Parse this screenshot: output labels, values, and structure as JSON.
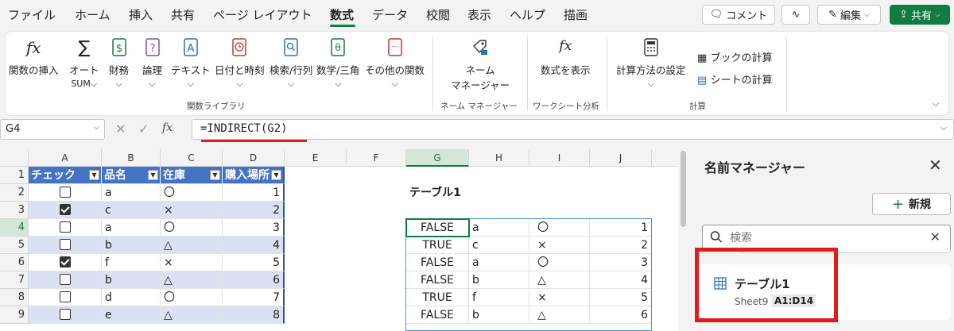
{
  "menubar": {
    "tabs": [
      "ファイル",
      "ホーム",
      "挿入",
      "共有",
      "ページ レイアウト",
      "数式",
      "データ",
      "校閲",
      "表示",
      "ヘルプ",
      "描画"
    ],
    "active_tab": "数式",
    "comment_label": "コメント",
    "edit_label": "編集",
    "share_label": "共有"
  },
  "ribbon": {
    "insert_function": "関数の挿入",
    "autosum": "オート",
    "autosum_sub": "SUM",
    "financial": "財務",
    "logical": "論理",
    "text": "テキスト",
    "datetime": "日付と時刻",
    "lookup": "検索/行列",
    "math": "数学/三角",
    "more": "その他の関数",
    "group_library": "関数ライブラリ",
    "name_manager_line1": "ネーム",
    "name_manager_line2": "マネージャー",
    "group_names": "ネーム マネージャー",
    "show_formulas": "数式を表示",
    "group_audit": "ワークシート分析",
    "calc_options": "計算方法の設定",
    "calc_book": "ブックの計算",
    "calc_sheet": "シートの計算",
    "group_calc": "計算"
  },
  "formula_bar": {
    "name_box": "G4",
    "formula": "=INDIRECT(G2)",
    "fx": "fx"
  },
  "grid": {
    "columns": [
      "A",
      "B",
      "C",
      "D",
      "E",
      "F",
      "G",
      "H",
      "I",
      "J"
    ],
    "rows": [
      "1",
      "2",
      "3",
      "4",
      "5",
      "6",
      "7",
      "8",
      "9"
    ],
    "table_headers": [
      "チェック",
      "品名",
      "在庫",
      "購入場所"
    ],
    "table_rows": [
      {
        "checked": false,
        "name": "a",
        "stock": "〇",
        "place": "1"
      },
      {
        "checked": true,
        "name": "c",
        "stock": "×",
        "place": "2"
      },
      {
        "checked": false,
        "name": "a",
        "stock": "〇",
        "place": "3"
      },
      {
        "checked": false,
        "name": "b",
        "stock": "△",
        "place": "4"
      },
      {
        "checked": true,
        "name": "f",
        "stock": "×",
        "place": "5"
      },
      {
        "checked": false,
        "name": "b",
        "stock": "△",
        "place": "6"
      },
      {
        "checked": false,
        "name": "d",
        "stock": "〇",
        "place": "7"
      },
      {
        "checked": false,
        "name": "e",
        "stock": "△",
        "place": "8"
      }
    ],
    "g2_label": "テーブル1",
    "spill_rows": [
      {
        "g": "FALSE",
        "h": "a",
        "i": "〇",
        "j": "1"
      },
      {
        "g": "TRUE",
        "h": "c",
        "i": "×",
        "j": "2"
      },
      {
        "g": "FALSE",
        "h": "a",
        "i": "〇",
        "j": "3"
      },
      {
        "g": "FALSE",
        "h": "b",
        "i": "△",
        "j": "4"
      },
      {
        "g": "TRUE",
        "h": "f",
        "i": "×",
        "j": "5"
      },
      {
        "g": "FALSE",
        "h": "b",
        "i": "△",
        "j": "6"
      }
    ]
  },
  "name_manager": {
    "title": "名前マネージャー",
    "new_label": "新規",
    "search_placeholder": "検索",
    "item_name": "テーブル1",
    "item_sheet": "Sheet9",
    "item_range": "A1:D14"
  },
  "colors": {
    "accent": "#107c41",
    "table_header": "#4472c4",
    "band": "#d9e1f2",
    "highlight": "#e01b1b"
  }
}
